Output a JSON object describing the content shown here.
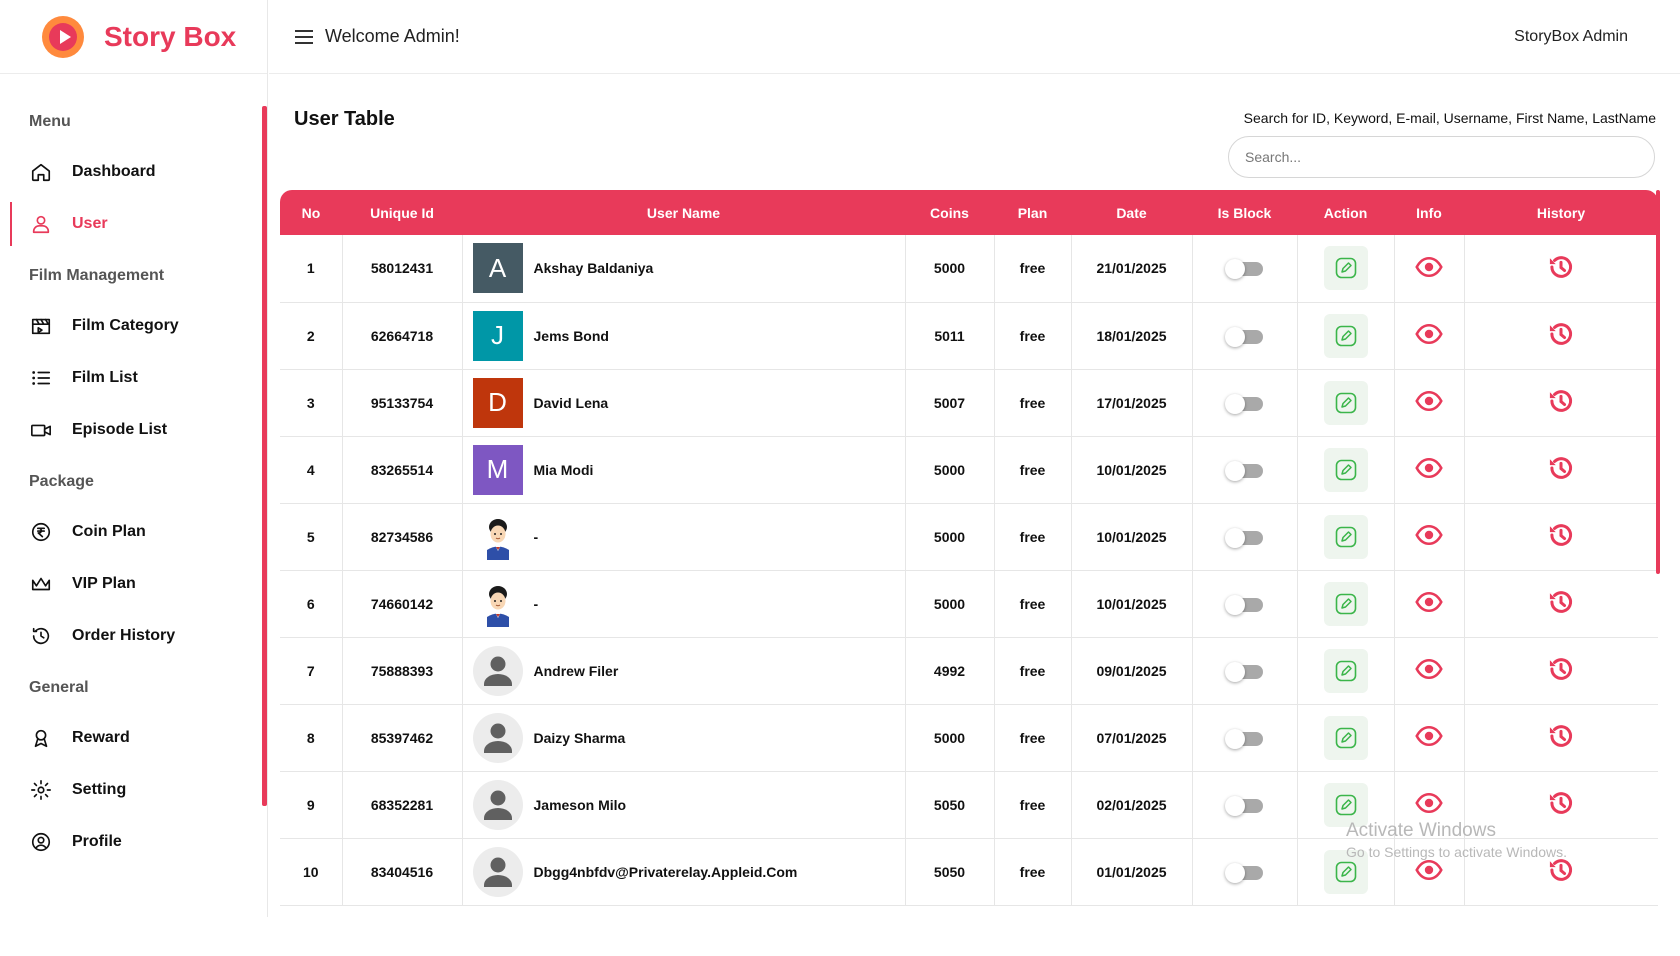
{
  "brand": {
    "name": "Story Box",
    "accent": "#e83a5a",
    "logo_orange": "#ff8a3d"
  },
  "header": {
    "welcome": "Welcome Admin!",
    "admin": "StoryBox Admin",
    "menu_icon": "hamburger-icon"
  },
  "sidebar": {
    "groups": [
      {
        "heading": "Menu",
        "items": [
          {
            "label": "Dashboard",
            "icon": "home-icon"
          },
          {
            "label": "User",
            "icon": "user-icon",
            "active": true
          }
        ]
      },
      {
        "heading": "Film Management",
        "items": [
          {
            "label": "Film Category",
            "icon": "clapperboard-icon"
          },
          {
            "label": "Film List",
            "icon": "list-icon"
          },
          {
            "label": "Episode List",
            "icon": "video-camera-icon"
          }
        ]
      },
      {
        "heading": "Package",
        "items": [
          {
            "label": "Coin Plan",
            "icon": "rupee-coin-icon"
          },
          {
            "label": "VIP Plan",
            "icon": "crown-icon"
          },
          {
            "label": "Order History",
            "icon": "history-icon"
          }
        ]
      },
      {
        "heading": "General",
        "items": [
          {
            "label": "Reward",
            "icon": "award-icon"
          },
          {
            "label": "Setting",
            "icon": "gear-icon"
          },
          {
            "label": "Profile",
            "icon": "user-circle-icon"
          }
        ]
      }
    ]
  },
  "main": {
    "title": "User Table",
    "search_label": "Search for ID, Keyword, E-mail, Username, First Name, LastName",
    "search_placeholder": "Search...",
    "columns": [
      "No",
      "Unique Id",
      "User Name",
      "Coins",
      "Plan",
      "Date",
      "Is Block",
      "Action",
      "Info",
      "History"
    ],
    "rows": [
      {
        "no": "1",
        "id": "58012431",
        "name": "Akshay Baldaniya",
        "avatar": {
          "type": "letter",
          "letter": "A",
          "color": "#455a64"
        },
        "coins": "5000",
        "plan": "free",
        "date": "21/01/2025",
        "blocked": false
      },
      {
        "no": "2",
        "id": "62664718",
        "name": "Jems Bond",
        "avatar": {
          "type": "letter",
          "letter": "J",
          "color": "#0097a7"
        },
        "coins": "5011",
        "plan": "free",
        "date": "18/01/2025",
        "blocked": false
      },
      {
        "no": "3",
        "id": "95133754",
        "name": "David Lena",
        "avatar": {
          "type": "letter",
          "letter": "D",
          "color": "#bf360c"
        },
        "coins": "5007",
        "plan": "free",
        "date": "17/01/2025",
        "blocked": false
      },
      {
        "no": "4",
        "id": "83265514",
        "name": "Mia Modi",
        "avatar": {
          "type": "letter",
          "letter": "M",
          "color": "#7e57c2"
        },
        "coins": "5000",
        "plan": "free",
        "date": "10/01/2025",
        "blocked": false
      },
      {
        "no": "5",
        "id": "82734586",
        "name": "-",
        "avatar": {
          "type": "cartoon"
        },
        "coins": "5000",
        "plan": "free",
        "date": "10/01/2025",
        "blocked": false
      },
      {
        "no": "6",
        "id": "74660142",
        "name": "-",
        "avatar": {
          "type": "cartoon"
        },
        "coins": "5000",
        "plan": "free",
        "date": "10/01/2025",
        "blocked": false
      },
      {
        "no": "7",
        "id": "75888393",
        "name": "Andrew Filer",
        "avatar": {
          "type": "default"
        },
        "coins": "4992",
        "plan": "free",
        "date": "09/01/2025",
        "blocked": false
      },
      {
        "no": "8",
        "id": "85397462",
        "name": "Daizy Sharma",
        "avatar": {
          "type": "default"
        },
        "coins": "5000",
        "plan": "free",
        "date": "07/01/2025",
        "blocked": false
      },
      {
        "no": "9",
        "id": "68352281",
        "name": "Jameson Milo",
        "avatar": {
          "type": "default"
        },
        "coins": "5050",
        "plan": "free",
        "date": "02/01/2025",
        "blocked": false
      },
      {
        "no": "10",
        "id": "83404516",
        "name": "Dbgg4nbfdv@Privaterelay.Appleid.Com",
        "avatar": {
          "type": "default"
        },
        "coins": "5050",
        "plan": "free",
        "date": "01/01/2025",
        "blocked": false
      }
    ],
    "icons": {
      "action": "edit-icon",
      "info": "eye-icon",
      "history": "history-icon"
    },
    "colors": {
      "edit_green": "#3bb54a",
      "edit_bg": "#eef5ee",
      "toggle_off": "#a9a9a9"
    }
  },
  "watermark": {
    "line1": "Activate Windows",
    "line2": "Go to Settings to activate Windows."
  }
}
